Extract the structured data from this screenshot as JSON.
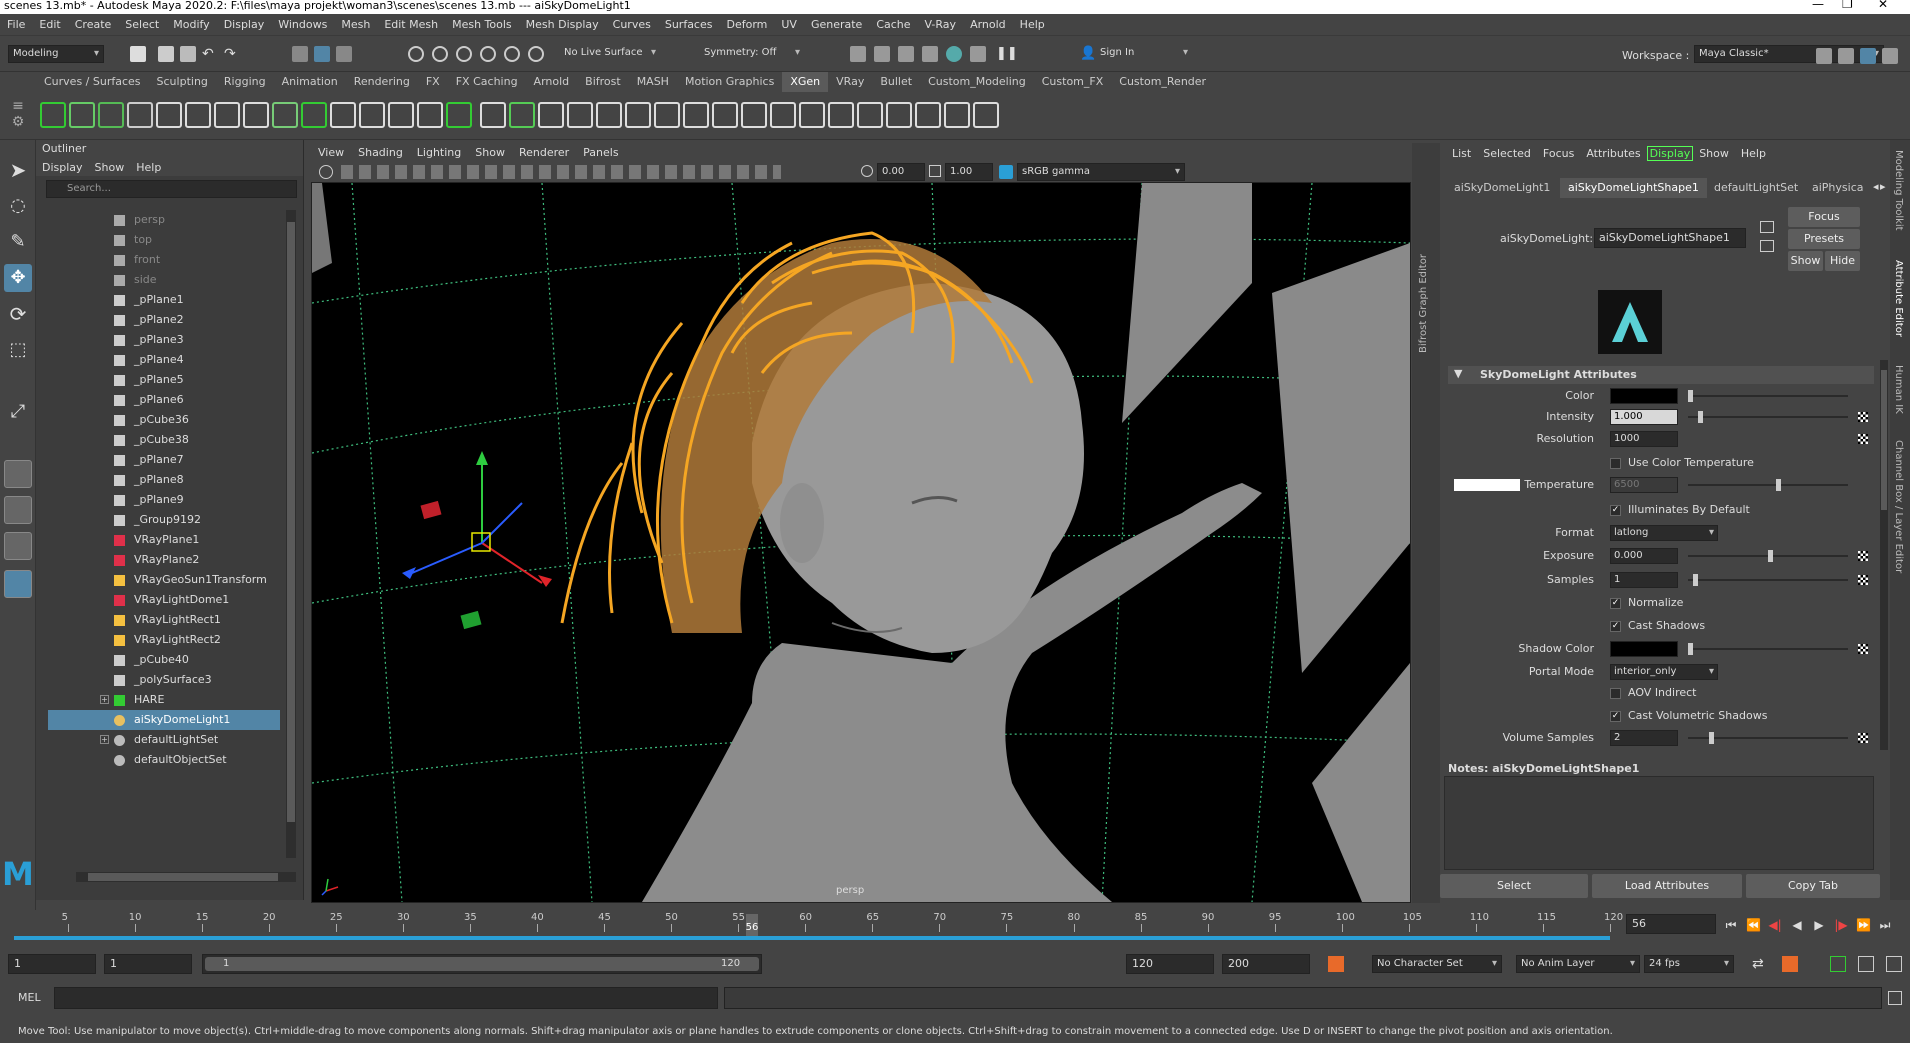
{
  "window": {
    "title": "scenes 13.mb* - Autodesk Maya 2020.2: F:\\files\\maya projekt\\woman3\\scenes\\scenes 13.mb   ---   aiSkyDomeLight1"
  },
  "menubar": [
    "File",
    "Edit",
    "Create",
    "Select",
    "Modify",
    "Display",
    "Windows",
    "Mesh",
    "Edit Mesh",
    "Mesh Tools",
    "Mesh Display",
    "Curves",
    "Surfaces",
    "Deform",
    "UV",
    "Generate",
    "Cache",
    "V-Ray",
    "Arnold",
    "Help"
  ],
  "workspace": {
    "label": "Workspace :",
    "value": "Maya Classic*"
  },
  "statusline": {
    "mode": "Modeling",
    "live_surface": "No Live Surface",
    "symmetry": "Symmetry: Off",
    "signin": "Sign In"
  },
  "shelf_tabs": [
    "Curves / Surfaces",
    "Sculpting",
    "Rigging",
    "Animation",
    "Rendering",
    "FX",
    "FX Caching",
    "Arnold",
    "Bifrost",
    "MASH",
    "Motion Graphics",
    "XGen",
    "VRay",
    "Bullet",
    "Custom_Modeling",
    "Custom_FX",
    "Custom_Render"
  ],
  "shelf_active": "XGen",
  "outliner": {
    "title": "Outliner",
    "menu": [
      "Display",
      "Show",
      "Help"
    ],
    "search_placeholder": "Search...",
    "items": [
      {
        "label": "persp",
        "kind": "camera",
        "dim": true
      },
      {
        "label": "top",
        "kind": "camera",
        "dim": true
      },
      {
        "label": "front",
        "kind": "camera",
        "dim": true
      },
      {
        "label": "side",
        "kind": "camera",
        "dim": true
      },
      {
        "label": "_pPlane1",
        "kind": "mesh"
      },
      {
        "label": "_pPlane2",
        "kind": "mesh"
      },
      {
        "label": "_pPlane3",
        "kind": "mesh"
      },
      {
        "label": "_pPlane4",
        "kind": "mesh"
      },
      {
        "label": "_pPlane5",
        "kind": "mesh"
      },
      {
        "label": "_pPlane6",
        "kind": "mesh"
      },
      {
        "label": "_pCube36",
        "kind": "mesh"
      },
      {
        "label": "_pCube38",
        "kind": "mesh"
      },
      {
        "label": "_pPlane7",
        "kind": "mesh"
      },
      {
        "label": "_pPlane8",
        "kind": "mesh"
      },
      {
        "label": "_pPlane9",
        "kind": "mesh"
      },
      {
        "label": "_Group9192",
        "kind": "mesh"
      },
      {
        "label": "VRayPlane1",
        "kind": "vray"
      },
      {
        "label": "VRayPlane2",
        "kind": "vray"
      },
      {
        "label": "VRayGeoSun1Transform",
        "kind": "sun"
      },
      {
        "label": "VRayLightDome1",
        "kind": "vray"
      },
      {
        "label": "VRayLightRect1",
        "kind": "rect"
      },
      {
        "label": "VRayLightRect2",
        "kind": "rect"
      },
      {
        "label": "_pCube40",
        "kind": "mesh"
      },
      {
        "label": "_polySurface3",
        "kind": "mesh"
      },
      {
        "label": "HARE",
        "kind": "xgen",
        "expand": true
      },
      {
        "label": "aiSkyDomeLight1",
        "kind": "dome",
        "selected": true
      },
      {
        "label": "defaultLightSet",
        "kind": "set",
        "expand": true
      },
      {
        "label": "defaultObjectSet",
        "kind": "set"
      }
    ]
  },
  "viewport": {
    "menu": [
      "View",
      "Shading",
      "Lighting",
      "Show",
      "Renderer",
      "Panels"
    ],
    "exposure": "0.00",
    "gamma": "1.00",
    "colorspace": "sRGB gamma",
    "camera_label": "persp"
  },
  "sidetabs": [
    "Bifrost Graph Editor"
  ],
  "sidetabs_right": [
    "Modeling Toolkit",
    "Attribute Editor",
    "Human IK",
    "Channel Box / Layer Editor"
  ],
  "attribute_editor": {
    "menu": [
      "List",
      "Selected",
      "Focus",
      "Attributes",
      "Display",
      "Show",
      "Help"
    ],
    "menu_highlight": "Display",
    "tabs": [
      "aiSkyDomeLight1",
      "aiSkyDomeLightShape1",
      "defaultLightSet",
      "aiPhysica"
    ],
    "active_tab": "aiSkyDomeLightShape1",
    "node_label": "aiSkyDomeLight:",
    "node_value": "aiSkyDomeLightShape1",
    "buttons": {
      "focus": "Focus",
      "presets": "Presets",
      "show": "Show",
      "hide": "Hide"
    },
    "section": "SkyDomeLight Attributes",
    "attrs": {
      "color_label": "Color",
      "intensity_label": "Intensity",
      "intensity": "1.000",
      "resolution_label": "Resolution",
      "resolution": "1000",
      "use_color_temp": "Use Color Temperature",
      "temperature_label": "Temperature",
      "temperature": "6500",
      "illuminates": "Illuminates By Default",
      "format_label": "Format",
      "format": "latlong",
      "exposure_label": "Exposure",
      "exposure": "0.000",
      "samples_label": "Samples",
      "samples": "1",
      "normalize": "Normalize",
      "cast_shadows": "Cast Shadows",
      "shadow_color_label": "Shadow Color",
      "portal_label": "Portal Mode",
      "portal": "interior_only",
      "aov_indirect": "AOV Indirect",
      "cast_vol_shadows": "Cast Volumetric Shadows",
      "volume_samples_label": "Volume Samples",
      "volume_samples": "2"
    },
    "notes": "Notes:  aiSkyDomeLightShape1",
    "bottom_buttons": [
      "Select",
      "Load Attributes",
      "Copy Tab"
    ]
  },
  "timeline": {
    "ticks": [
      "5",
      "10",
      "15",
      "20",
      "25",
      "30",
      "35",
      "40",
      "45",
      "50",
      "55",
      "60",
      "65",
      "70",
      "75",
      "80",
      "85",
      "90",
      "95",
      "100",
      "105",
      "110",
      "115",
      "120"
    ],
    "current": "56",
    "current_frame_field": "56"
  },
  "range": {
    "start": "1",
    "start2": "1",
    "slider_start": "1",
    "slider_end": "120",
    "end": "120",
    "end2": "200",
    "character_set": "No Character Set",
    "anim_layer": "No Anim Layer",
    "fps": "24 fps"
  },
  "cmdline": {
    "label": "MEL"
  },
  "helpline": "Move Tool: Use manipulator to move object(s). Ctrl+middle-drag to move components along normals. Shift+drag manipulator axis or plane handles to extrude components or clone objects. Ctrl+Shift+drag to constrain movement to a connected edge. Use D or INSERT to change the pivot position and axis orientation.",
  "colors": {
    "accent": "#5285a6",
    "hair_guides": "#f5a623",
    "grid": "#3fbf7f"
  }
}
